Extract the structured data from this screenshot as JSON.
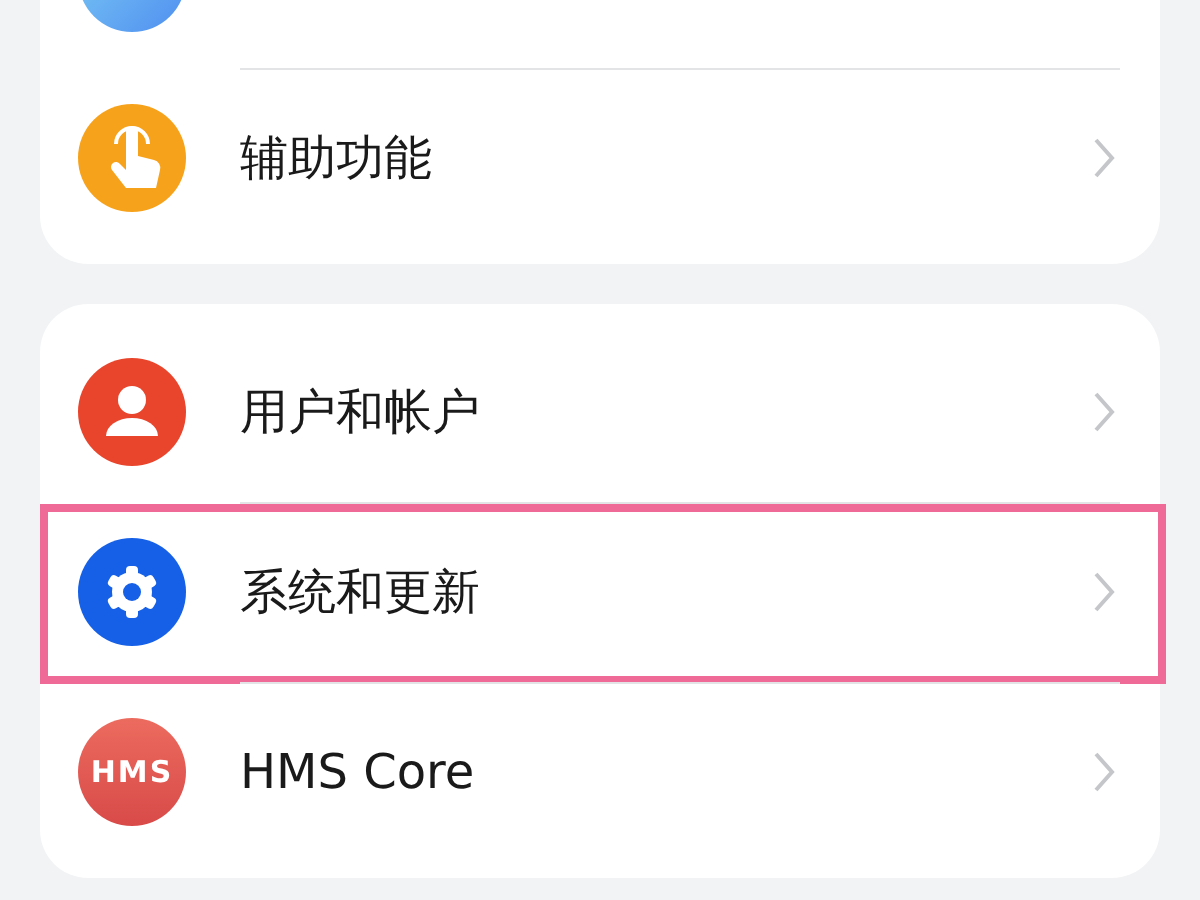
{
  "groups": [
    {
      "rows": [
        {
          "kind": "gradient",
          "highlighted": false
        },
        {
          "kind": "hand",
          "label": "辅助功能",
          "highlighted": false
        }
      ]
    },
    {
      "rows": [
        {
          "kind": "person",
          "label": "用户和帐户",
          "highlighted": false
        },
        {
          "kind": "gear",
          "label": "系统和更新",
          "highlighted": true
        },
        {
          "kind": "badge",
          "icon_text": "HMS",
          "label": "HMS Core",
          "highlighted": false
        }
      ]
    }
  ]
}
